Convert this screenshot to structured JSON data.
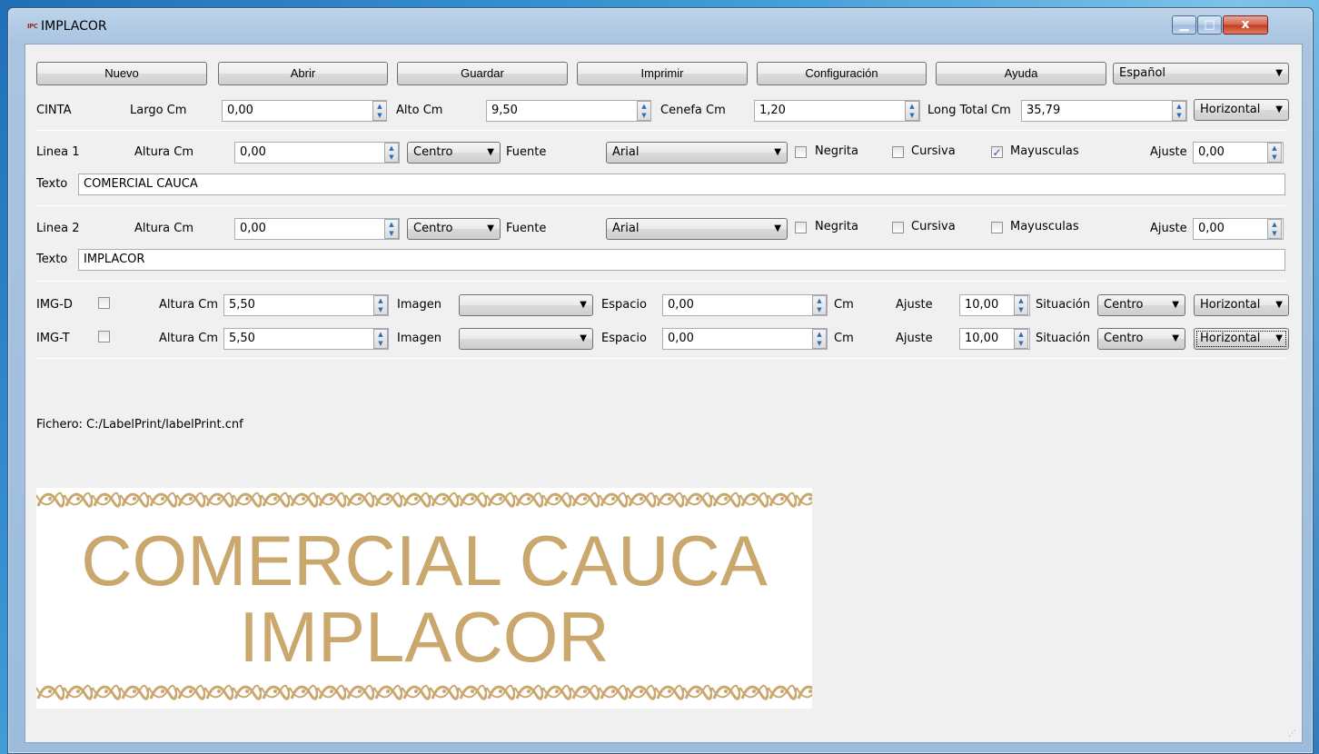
{
  "window": {
    "title": "IMPLACOR",
    "icon_text": "IPC",
    "min_glyph": "▁",
    "max_glyph": "□",
    "close_glyph": "x"
  },
  "toolbar": {
    "buttons": [
      "Nuevo",
      "Abrir",
      "Guardar",
      "Imprimir",
      "Configuración",
      "Ayuda"
    ],
    "language": "Español"
  },
  "cinta": {
    "label": "CINTA",
    "largo_label": "Largo Cm",
    "largo_value": "0,00",
    "alto_label": "Alto Cm",
    "alto_value": "9,50",
    "cenefa_label": "Cenefa Cm",
    "cenefa_value": "1,20",
    "long_total_label": "Long Total Cm",
    "long_total_value": "35,79",
    "orientation": "Horizontal"
  },
  "linea1": {
    "label": "Linea 1",
    "altura_label": "Altura Cm",
    "altura_value": "0,00",
    "align": "Centro",
    "fuente_label": "Fuente",
    "fuente_value": "Arial",
    "negrita_label": "Negrita",
    "negrita_checked": false,
    "cursiva_label": "Cursiva",
    "cursiva_checked": false,
    "mayusculas_label": "Mayusculas",
    "mayusculas_checked": true,
    "ajuste_label": "Ajuste",
    "ajuste_value": "0,00",
    "texto_label": "Texto",
    "texto_value": "COMERCIAL CAUCA"
  },
  "linea2": {
    "label": "Linea 2",
    "altura_label": "Altura Cm",
    "altura_value": "0,00",
    "align": "Centro",
    "fuente_label": "Fuente",
    "fuente_value": "Arial",
    "negrita_label": "Negrita",
    "negrita_checked": false,
    "cursiva_label": "Cursiva",
    "cursiva_checked": false,
    "mayusculas_label": "Mayusculas",
    "mayusculas_checked": false,
    "ajuste_label": "Ajuste",
    "ajuste_value": "0,00",
    "texto_label": "Texto",
    "texto_value": "IMPLACOR"
  },
  "img_d": {
    "label": "IMG-D",
    "checked": false,
    "altura_label": "Altura Cm",
    "altura_value": "5,50",
    "imagen_label": "Imagen",
    "imagen_value": "",
    "espacio_label": "Espacio",
    "espacio_value": "0,00",
    "cm_label": "Cm",
    "ajuste_label": "Ajuste",
    "ajuste_value": "10,00",
    "situacion_label": "Situación",
    "situacion_value": "Centro",
    "orientation": "Horizontal"
  },
  "img_t": {
    "label": "IMG-T",
    "checked": false,
    "altura_label": "Altura Cm",
    "altura_value": "5,50",
    "imagen_label": "Imagen",
    "imagen_value": "",
    "espacio_label": "Espacio",
    "espacio_value": "0,00",
    "cm_label": "Cm",
    "ajuste_label": "Ajuste",
    "ajuste_value": "10,00",
    "situacion_label": "Situación",
    "situacion_value": "Centro",
    "orientation": "Horizontal"
  },
  "status": {
    "fichero": "Fichero: C:/LabelPrint/labelPrint.cnf"
  },
  "preview": {
    "line1": "COMERCIAL CAUCA",
    "line2": "IMPLACOR",
    "text_color": "#c9a76d",
    "border_color": "#c9a76d"
  },
  "glyphs": {
    "spin_up": "▲",
    "spin_down": "▼",
    "dropdown": "▼",
    "check": "✓",
    "grip": "⋰"
  }
}
